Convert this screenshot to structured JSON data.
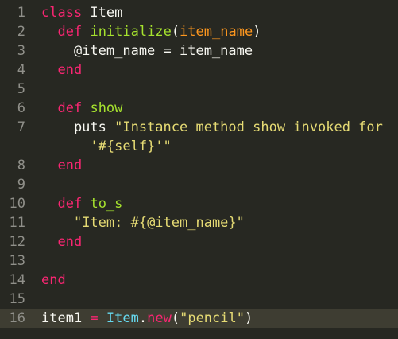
{
  "editor": {
    "colors": {
      "background": "#272822",
      "current_line": "#3e3d32",
      "gutter_text": "#90908a",
      "keyword": "#f92672",
      "function_name": "#a6e22e",
      "parameter": "#fd971f",
      "string": "#e6db74",
      "constant": "#66d9ef",
      "plain": "#f8f8f2"
    },
    "lines": [
      {
        "num": "1",
        "tokens": [
          {
            "t": "class",
            "c": "kw"
          },
          {
            "t": " Item",
            "c": "plain"
          }
        ]
      },
      {
        "num": "2",
        "tokens": [
          {
            "t": "  ",
            "c": "plain"
          },
          {
            "t": "def",
            "c": "kw"
          },
          {
            "t": " ",
            "c": "plain"
          },
          {
            "t": "initialize",
            "c": "fn"
          },
          {
            "t": "(",
            "c": "plain"
          },
          {
            "t": "item_name",
            "c": "param"
          },
          {
            "t": ")",
            "c": "plain"
          }
        ]
      },
      {
        "num": "3",
        "tokens": [
          {
            "t": "    @item_name = item_name",
            "c": "plain"
          }
        ]
      },
      {
        "num": "4",
        "tokens": [
          {
            "t": "  ",
            "c": "plain"
          },
          {
            "t": "end",
            "c": "kw"
          }
        ]
      },
      {
        "num": "5",
        "tokens": []
      },
      {
        "num": "6",
        "tokens": [
          {
            "t": "  ",
            "c": "plain"
          },
          {
            "t": "def",
            "c": "kw"
          },
          {
            "t": " ",
            "c": "plain"
          },
          {
            "t": "show",
            "c": "fn"
          }
        ]
      },
      {
        "num": "7",
        "tokens": [
          {
            "t": "    puts ",
            "c": "plain"
          },
          {
            "t": "\"Instance method show invoked for",
            "c": "str"
          }
        ]
      },
      {
        "num": "",
        "tokens": [
          {
            "t": "      ",
            "c": "plain"
          },
          {
            "t": "'#{self}'\"",
            "c": "str"
          }
        ]
      },
      {
        "num": "8",
        "tokens": [
          {
            "t": "  ",
            "c": "plain"
          },
          {
            "t": "end",
            "c": "kw"
          }
        ]
      },
      {
        "num": "9",
        "tokens": []
      },
      {
        "num": "10",
        "tokens": [
          {
            "t": "  ",
            "c": "plain"
          },
          {
            "t": "def",
            "c": "kw"
          },
          {
            "t": " ",
            "c": "plain"
          },
          {
            "t": "to_s",
            "c": "fn"
          }
        ]
      },
      {
        "num": "11",
        "tokens": [
          {
            "t": "    ",
            "c": "plain"
          },
          {
            "t": "\"Item: #{@item_name}\"",
            "c": "str"
          }
        ]
      },
      {
        "num": "12",
        "tokens": [
          {
            "t": "  ",
            "c": "plain"
          },
          {
            "t": "end",
            "c": "kw"
          }
        ]
      },
      {
        "num": "13",
        "tokens": []
      },
      {
        "num": "14",
        "tokens": [
          {
            "t": "end",
            "c": "kw"
          }
        ]
      },
      {
        "num": "15",
        "tokens": []
      },
      {
        "num": "16",
        "current": true,
        "tokens": [
          {
            "t": "item1 ",
            "c": "plain"
          },
          {
            "t": "=",
            "c": "kw"
          },
          {
            "t": " ",
            "c": "plain"
          },
          {
            "t": "Item",
            "c": "cls"
          },
          {
            "t": ".",
            "c": "plain"
          },
          {
            "t": "new",
            "c": "kw"
          },
          {
            "t": "(",
            "c": "plain u"
          },
          {
            "t": "\"pencil\"",
            "c": "str"
          },
          {
            "t": ")",
            "c": "plain u"
          }
        ]
      }
    ]
  }
}
